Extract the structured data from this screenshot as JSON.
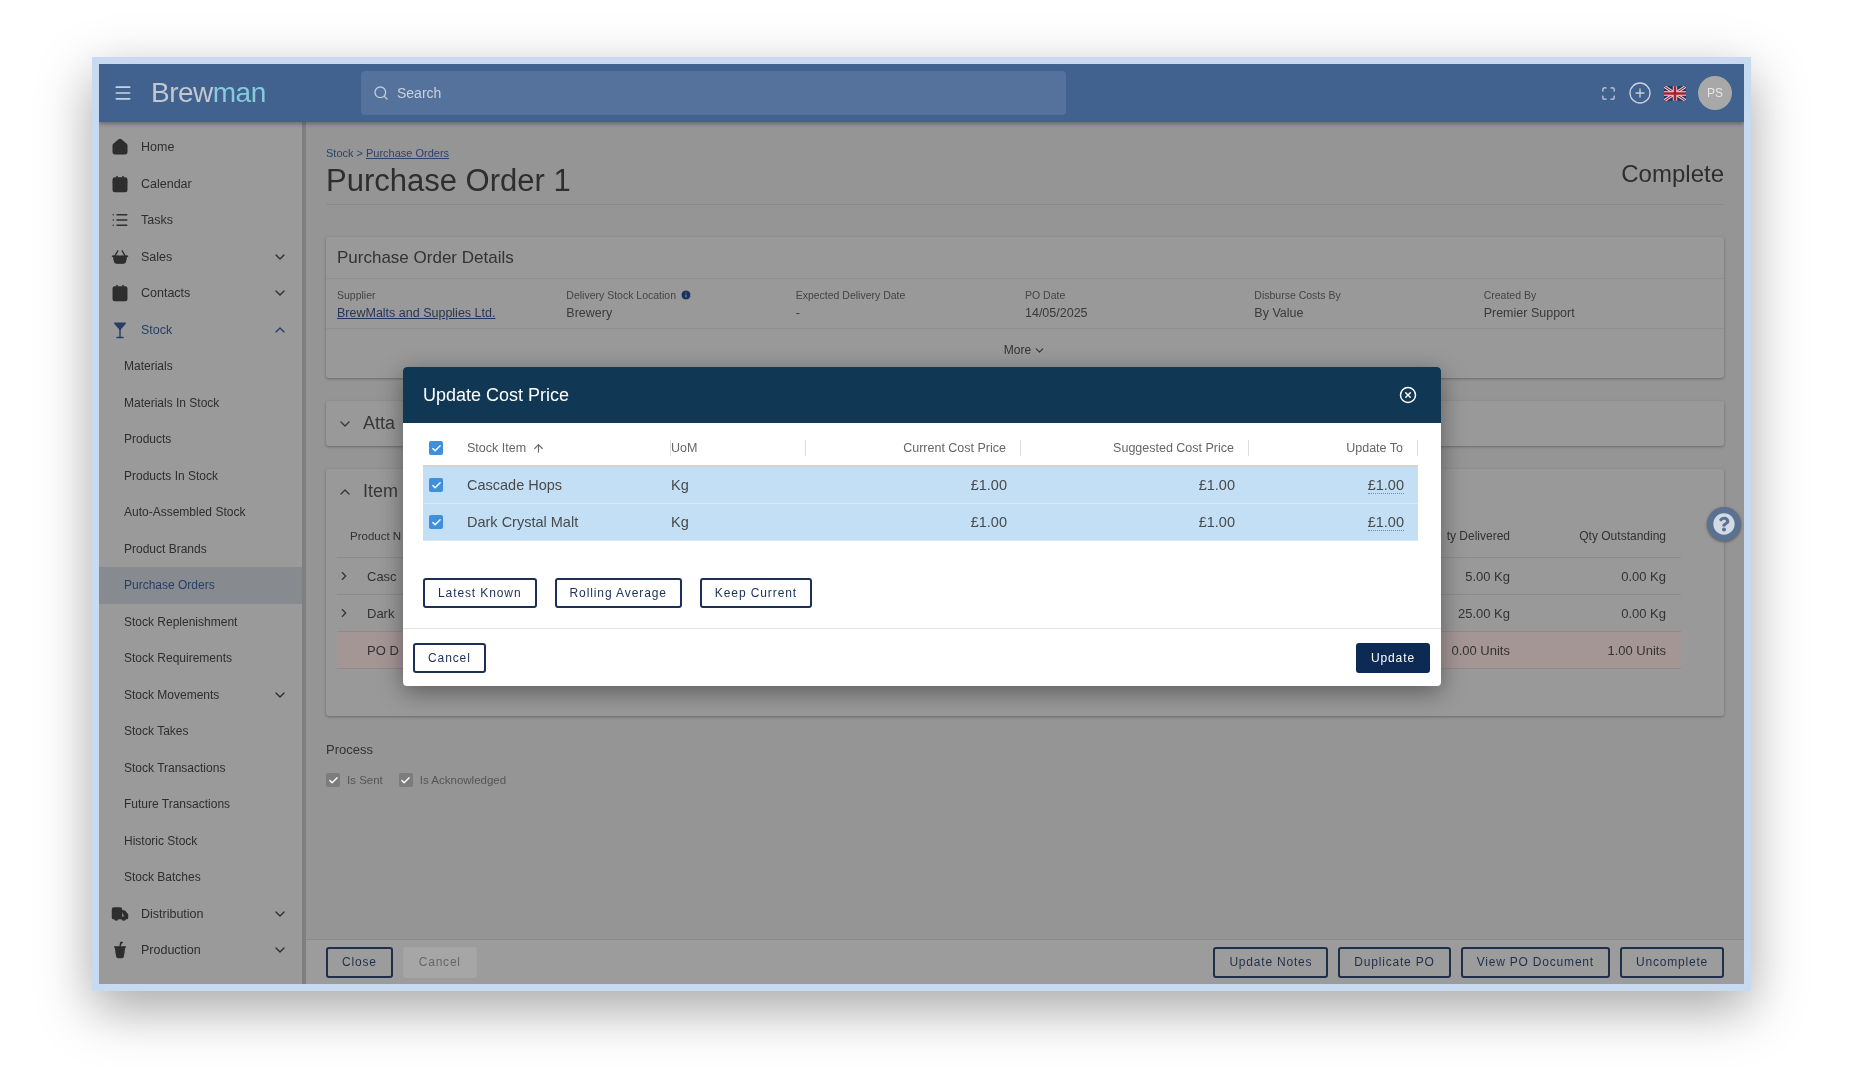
{
  "topbar": {
    "logo": {
      "part_1": "Brew",
      "part_2": "man"
    },
    "search": {
      "placeholder": "Search"
    },
    "avatar": "PS"
  },
  "sidebar": {
    "items": [
      {
        "label": "Home",
        "selected": false
      },
      {
        "label": "Calendar",
        "selected": false
      },
      {
        "label": "Tasks",
        "selected": false
      },
      {
        "label": "Sales",
        "selected": false,
        "expanded": false
      },
      {
        "label": "Contacts",
        "selected": false,
        "expanded": false
      },
      {
        "label": "Stock",
        "selected": false,
        "expanded": true,
        "children": [
          {
            "label": "Materials",
            "selected": false
          },
          {
            "label": "Materials In Stock",
            "selected": false
          },
          {
            "label": "Products",
            "selected": false
          },
          {
            "label": "Products In Stock",
            "selected": false
          },
          {
            "label": "Auto-Assembled Stock",
            "selected": false
          },
          {
            "label": "Product Brands",
            "selected": false
          },
          {
            "label": "Purchase Orders",
            "selected": true
          },
          {
            "label": "Stock Replenishment",
            "selected": false
          },
          {
            "label": "Stock Requirements",
            "selected": false
          },
          {
            "label": "Stock Movements",
            "selected": false,
            "expanded": false
          },
          {
            "label": "Stock Takes",
            "selected": false
          },
          {
            "label": "Stock Transactions",
            "selected": false
          },
          {
            "label": "Future Transactions",
            "selected": false
          },
          {
            "label": "Historic Stock",
            "selected": false
          },
          {
            "label": "Stock Batches",
            "selected": false
          }
        ]
      },
      {
        "label": "Distribution",
        "selected": false,
        "expanded": false
      },
      {
        "label": "Production",
        "selected": false,
        "expanded": false
      }
    ]
  },
  "main": {
    "breadcrumb": {
      "parent": "Stock",
      "separator": ">",
      "current": "Purchase Orders"
    },
    "title": "Purchase Order 1",
    "status": "Complete",
    "details": {
      "title": "Purchase Order Details",
      "more": "More",
      "fields": [
        {
          "label": "Supplier",
          "value": "BrewMalts and Supplies Ltd.",
          "link": true,
          "info": false
        },
        {
          "label": "Delivery Stock Location",
          "value": "Brewery",
          "link": false,
          "info": true
        },
        {
          "label": "Expected Delivery Date",
          "value": "-",
          "link": false,
          "info": false
        },
        {
          "label": "PO Date",
          "value": "14/05/2025",
          "link": false,
          "info": false
        },
        {
          "label": "Disburse Costs By",
          "value": "By Value",
          "link": false,
          "info": false
        },
        {
          "label": "Created By",
          "value": "Premier Support",
          "link": false,
          "info": false
        }
      ]
    },
    "attachments": {
      "title": "Atta",
      "expanded": false
    },
    "items": {
      "title": "Item",
      "expanded": true,
      "columns": {
        "name": "Product N",
        "delivered": "ty Delivered",
        "outstanding": "Qty Outstanding"
      },
      "rows": [
        {
          "kind": "item",
          "name": "Casc",
          "delivered": "5.00 Kg",
          "outstanding": "0.00 Kg"
        },
        {
          "kind": "item",
          "name": "Dark",
          "delivered": "25.00 Kg",
          "outstanding": "0.00 Kg"
        },
        {
          "kind": "summary",
          "name": "PO D",
          "delivered": "0.00 Units",
          "outstanding": "1.00 Units"
        }
      ]
    },
    "process": {
      "title": "Process",
      "options": [
        {
          "label": "Is Sent",
          "checked": true
        },
        {
          "label": "Is Acknowledged",
          "checked": true
        }
      ]
    },
    "footer": {
      "left": [
        {
          "label": "Close",
          "disabled": false
        },
        {
          "label": "Cancel",
          "disabled": true
        }
      ],
      "right": [
        {
          "label": "Update Notes",
          "disabled": false
        },
        {
          "label": "Duplicate PO",
          "disabled": false
        },
        {
          "label": "View PO Document",
          "disabled": false
        },
        {
          "label": "Uncomplete",
          "disabled": false
        }
      ]
    }
  },
  "modal": {
    "title": "Update Cost Price",
    "select_all": true,
    "columns": [
      {
        "label": "Stock Item",
        "sorted": true,
        "editable": false
      },
      {
        "label": "UoM",
        "sorted": false,
        "editable": false
      },
      {
        "label": "Current Cost Price",
        "sorted": false,
        "editable": false
      },
      {
        "label": "Suggested Cost Price",
        "sorted": false,
        "editable": false
      },
      {
        "label": "Update To",
        "sorted": false,
        "editable": true
      }
    ],
    "rows": [
      {
        "checked": true,
        "cells": [
          "Cascade Hops",
          "Kg",
          "£1.00",
          "£1.00",
          "£1.00"
        ]
      },
      {
        "checked": true,
        "cells": [
          "Dark Crystal Malt",
          "Kg",
          "£1.00",
          "£1.00",
          "£1.00"
        ]
      }
    ],
    "methods": [
      "Latest Known",
      "Rolling Average",
      "Keep Current"
    ],
    "cancel": "Cancel",
    "submit": "Update"
  }
}
